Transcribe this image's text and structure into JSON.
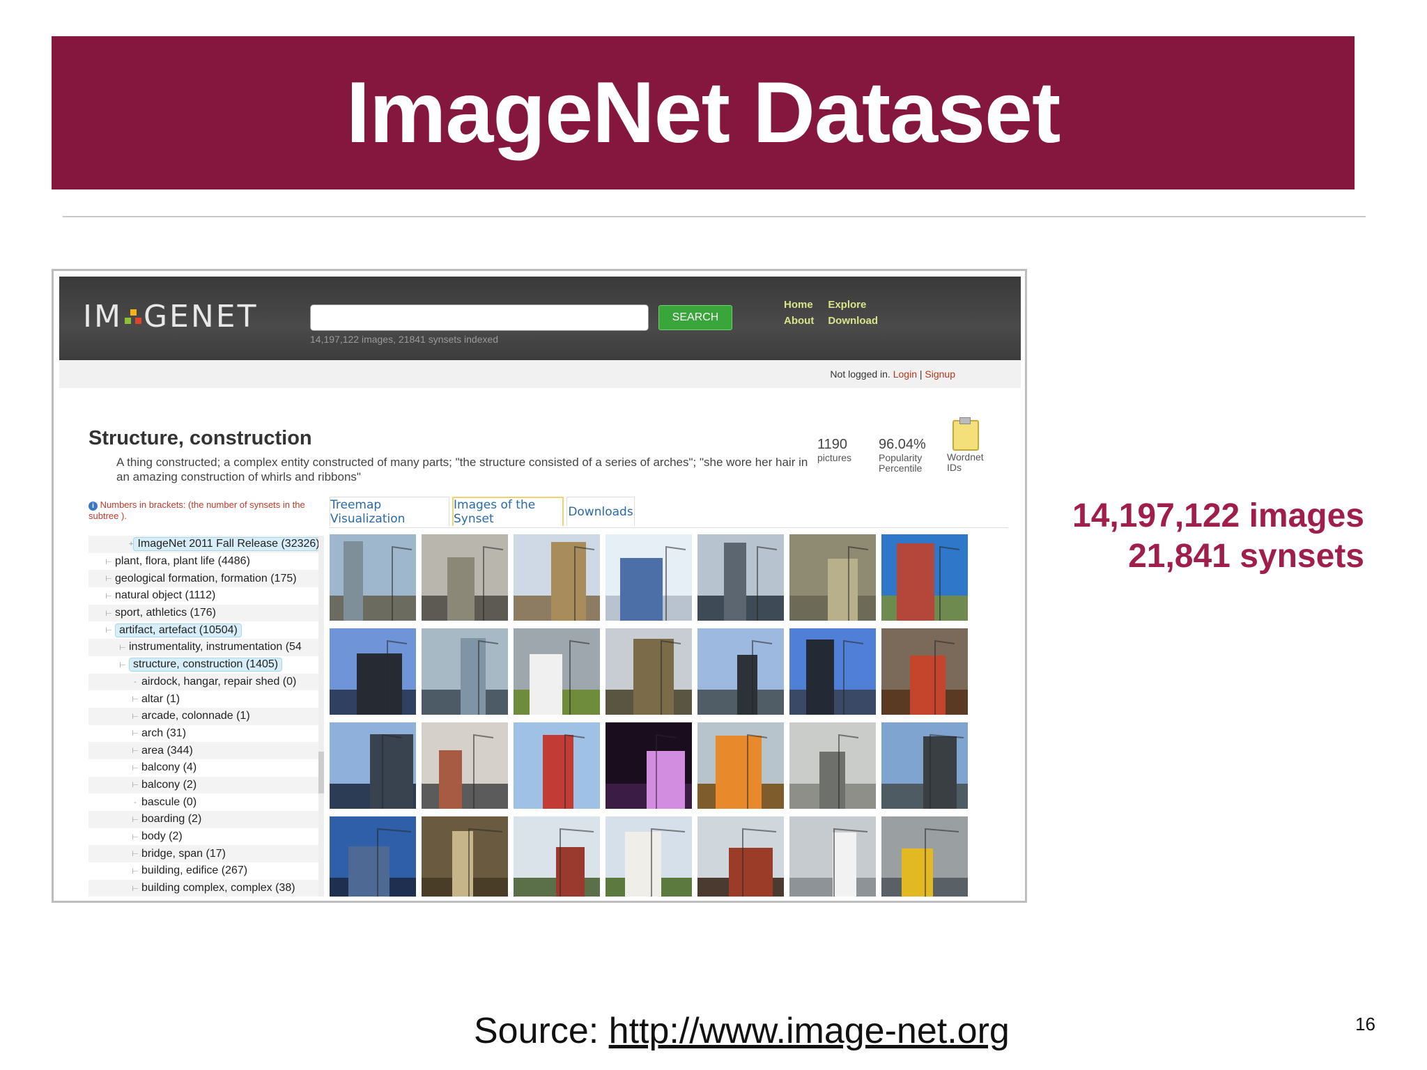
{
  "slide": {
    "title": "ImageNet Dataset",
    "stats_images": "14,197,122 images",
    "stats_synsets": "21,841 synsets",
    "source_prefix": "Source: ",
    "source_link": "http://www.image-net.org",
    "page_number": "16"
  },
  "colors": {
    "banner": "#85163d",
    "accent": "#a01e4b",
    "search_button": "#3aa53a",
    "nav_link": "#d9e48a"
  },
  "imagenet": {
    "logo_left": "IM",
    "logo_right": "GENET",
    "search": {
      "placeholder": "",
      "button": "SEARCH",
      "hint": "14,197,122 images, 21841 synsets indexed"
    },
    "nav": {
      "home": "Home",
      "explore": "Explore",
      "about": "About",
      "download": "Download"
    },
    "login": {
      "status": "Not logged in. ",
      "login": "Login",
      "separator": " | ",
      "signup": "Signup"
    },
    "synset": {
      "title": "Structure, construction",
      "description": "A thing constructed; a complex entity constructed of many parts; \"the structure consisted of a series of arches\"; \"she wore her hair in an amazing construction of whirls and ribbons\"",
      "pictures_value": "1190",
      "pictures_label": "pictures",
      "popularity_value": "96.04%",
      "popularity_label_1": "Popularity",
      "popularity_label_2": "Percentile",
      "wordnet_label_1": "Wordnet",
      "wordnet_label_2": "IDs"
    },
    "note": "Numbers in brackets: (the number of synsets in the subtree ).",
    "tree": [
      {
        "label": "ImageNet 2011 Fall Release (32326)",
        "glyph": "+",
        "highlight": true
      },
      {
        "label": "plant, flora, plant life (4486)",
        "glyph": "⊢",
        "highlight": false
      },
      {
        "label": "geological formation, formation (175)",
        "glyph": "⊢",
        "highlight": false
      },
      {
        "label": "natural object (1112)",
        "glyph": "⊢",
        "highlight": false
      },
      {
        "label": "sport, athletics (176)",
        "glyph": "⊢",
        "highlight": false
      },
      {
        "label": "artifact, artefact (10504)",
        "glyph": "⊢",
        "highlight": true
      },
      {
        "label": "instrumentality, instrumentation (54",
        "glyph": "⊢",
        "highlight": false
      },
      {
        "label": "structure, construction (1405)",
        "glyph": "⊢",
        "highlight": true
      },
      {
        "label": "airdock, hangar, repair shed (0)",
        "glyph": "-",
        "highlight": false
      },
      {
        "label": "altar (1)",
        "glyph": "⊢",
        "highlight": false
      },
      {
        "label": "arcade, colonnade (1)",
        "glyph": "⊢",
        "highlight": false
      },
      {
        "label": "arch (31)",
        "glyph": "⊢",
        "highlight": false
      },
      {
        "label": "area (344)",
        "glyph": "⊢",
        "highlight": false
      },
      {
        "label": "balcony (4)",
        "glyph": "⊢",
        "highlight": false
      },
      {
        "label": "balcony (2)",
        "glyph": "⊢",
        "highlight": false
      },
      {
        "label": "bascule (0)",
        "glyph": "-",
        "highlight": false
      },
      {
        "label": "boarding (2)",
        "glyph": "⊢",
        "highlight": false
      },
      {
        "label": "body (2)",
        "glyph": "⊢",
        "highlight": false
      },
      {
        "label": "bridge, span (17)",
        "glyph": "⊢",
        "highlight": false
      },
      {
        "label": "building, edifice (267)",
        "glyph": "⊢",
        "highlight": false
      },
      {
        "label": "building complex, complex (38)",
        "glyph": "⊢",
        "highlight": false
      }
    ],
    "tabs": [
      {
        "label": "Treemap Visualization",
        "active": false
      },
      {
        "label": "Images of the Synset",
        "active": true
      },
      {
        "label": "Downloads",
        "active": false
      }
    ],
    "thumbnails": [
      {
        "sky": "#9fb7cc",
        "ground": "#6b6b5f",
        "fg": "#7e8f99"
      },
      {
        "sky": "#b9b6ad",
        "ground": "#5c5a52",
        "fg": "#8c8878"
      },
      {
        "sky": "#cfd9e6",
        "ground": "#8d7b62",
        "fg": "#a88c5c"
      },
      {
        "sky": "#e6eef6",
        "ground": "#b9c3cf",
        "fg": "#4d6fa8"
      },
      {
        "sky": "#b7c4cf",
        "ground": "#3e4a55",
        "fg": "#5b6670"
      },
      {
        "sky": "#8f8a72",
        "ground": "#6e6a58",
        "fg": "#b8b08a"
      },
      {
        "sky": "#2f77c8",
        "ground": "#6f8a4e",
        "fg": "#b4473a"
      },
      {
        "sky": "#6f95d8",
        "ground": "#304060",
        "fg": "#262b33"
      },
      {
        "sky": "#a8b9c6",
        "ground": "#4d5b66",
        "fg": "#7f95a6"
      },
      {
        "sky": "#9ea7ad",
        "ground": "#6f8b3c",
        "fg": "#f0f0f0"
      },
      {
        "sky": "#c7cdd2",
        "ground": "#5a5540",
        "fg": "#7b6b48"
      },
      {
        "sky": "#9db9e0",
        "ground": "#505c66",
        "fg": "#2c3238"
      },
      {
        "sky": "#4f7fd6",
        "ground": "#3a4a66",
        "fg": "#232a35"
      },
      {
        "sky": "#7b6a5a",
        "ground": "#5b3a24",
        "fg": "#c4452b"
      },
      {
        "sky": "#8fb0da",
        "ground": "#2d3c55",
        "fg": "#394350"
      },
      {
        "sky": "#d5d0c9",
        "ground": "#5b5b5b",
        "fg": "#a65b42"
      },
      {
        "sky": "#9fc1e6",
        "ground": "#9fc1e6",
        "fg": "#c23b35"
      },
      {
        "sky": "#1a0d1e",
        "ground": "#3a1c45",
        "fg": "#d28ce0"
      },
      {
        "sky": "#b8c4cc",
        "ground": "#7f5c2c",
        "fg": "#e88a2c"
      },
      {
        "sky": "#c9ccc8",
        "ground": "#8e8f88",
        "fg": "#6e706b"
      },
      {
        "sky": "#7fa4cf",
        "ground": "#4f5b63",
        "fg": "#3a3f44"
      },
      {
        "sky": "#2e5fa8",
        "ground": "#1e2f4f",
        "fg": "#4e6a94"
      },
      {
        "sky": "#6a5a3f",
        "ground": "#4a3d28",
        "fg": "#c7b58a"
      },
      {
        "sky": "#dbe3ea",
        "ground": "#5b6f49",
        "fg": "#9a3a2e"
      },
      {
        "sky": "#d6e0ea",
        "ground": "#5d7a3e",
        "fg": "#efeee8"
      },
      {
        "sky": "#cfd6dc",
        "ground": "#4b3a2f",
        "fg": "#9a3c28"
      },
      {
        "sky": "#c5cbcf",
        "ground": "#8d9396",
        "fg": "#f2f2f2"
      },
      {
        "sky": "#9aa0a2",
        "ground": "#5a6166",
        "fg": "#e2b923"
      }
    ]
  }
}
